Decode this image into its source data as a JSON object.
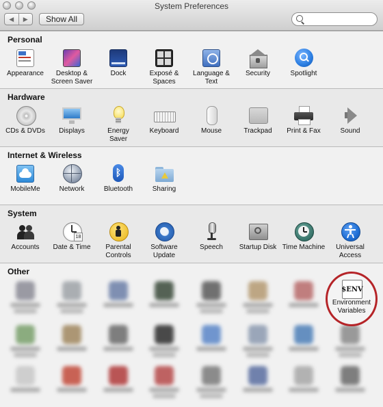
{
  "window": {
    "title": "System Preferences"
  },
  "toolbar": {
    "back_glyph": "◀",
    "forward_glyph": "▶",
    "show_all": "Show All",
    "search_placeholder": ""
  },
  "sections": {
    "personal": {
      "label": "Personal",
      "items": [
        "Appearance",
        "Desktop &\nScreen Saver",
        "Dock",
        "Exposé &\nSpaces",
        "Language &\nText",
        "Security",
        "Spotlight"
      ]
    },
    "hardware": {
      "label": "Hardware",
      "items": [
        "CDs & DVDs",
        "Displays",
        "Energy\nSaver",
        "Keyboard",
        "Mouse",
        "Trackpad",
        "Print & Fax",
        "Sound"
      ]
    },
    "internet": {
      "label": "Internet & Wireless",
      "items": [
        "MobileMe",
        "Network",
        "Bluetooth",
        "Sharing"
      ]
    },
    "system": {
      "label": "System",
      "items": [
        "Accounts",
        "Date & Time",
        "Parental\nControls",
        "Software\nUpdate",
        "Speech",
        "Startup Disk",
        "Time Machine",
        "Universal\nAccess"
      ]
    },
    "other": {
      "label": "Other",
      "env_icon_text": "$ENV",
      "env_label": "Environment\nVariables"
    }
  },
  "icons": {
    "appearance": "appearance-icon",
    "desktop": "desktop-icon",
    "dock": "dock-icon",
    "expose": "expose-icon",
    "language": "language-icon",
    "security": "security-icon",
    "spotlight": "spotlight-icon",
    "cds": "cd-icon",
    "displays": "display-icon",
    "energy": "bulb-icon",
    "keyboard": "keyboard-icon",
    "mouse": "mouse-icon",
    "trackpad": "trackpad-icon",
    "print": "printer-icon",
    "sound": "speaker-icon",
    "mobileme": "cloud-icon",
    "network": "globe-icon",
    "bluetooth": "bluetooth-icon",
    "sharing": "folder-icon",
    "accounts": "accounts-icon",
    "datetime": "clock-icon",
    "parental": "parental-icon",
    "software": "update-icon",
    "speech": "microphone-icon",
    "startup": "disk-icon",
    "timemachine": "time-machine-icon",
    "universal": "universal-access-icon"
  },
  "colors": {
    "highlight_ring": "#b52428",
    "spotlight_blue": "#2a7de1",
    "universal_blue": "#1f6fd6"
  }
}
